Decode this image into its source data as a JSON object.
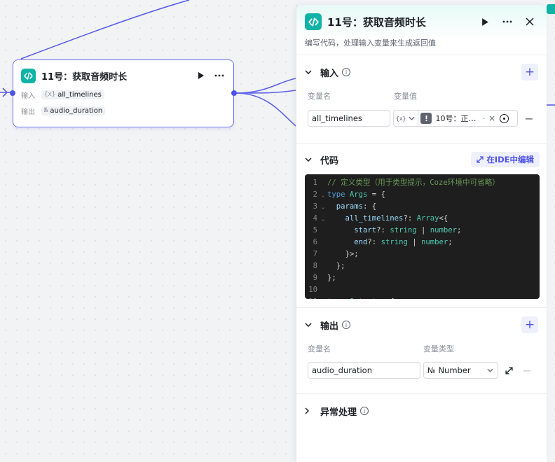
{
  "node": {
    "title": "11号：获取音频时长",
    "input_label": "输入",
    "input_icon": "{x}",
    "input_value": "all_timelines",
    "output_label": "输出",
    "output_icon": "№",
    "output_value": "audio_duration"
  },
  "panel": {
    "title": "11号：获取音频时长",
    "description": "编写代码，处理输入变量来生成返回值",
    "input_section": {
      "title": "输入",
      "col_name": "变量名",
      "col_value": "变量值",
      "var_name": "all_timelines",
      "ref_type_icon": "{x}",
      "ref_value": "10号：正…",
      "ref_suffix": "-",
      "ref_clear": "×"
    },
    "code_section": {
      "title": "代码",
      "ide_button": "在IDE中编辑",
      "lines": [
        "// 定义类型（用于类型提示，Coze环境中可省略）",
        "type Args = {",
        "  params: {",
        "    all_timelines?: Array<{",
        "      start?: string | number;",
        "      end?: string | number;",
        "    }>;",
        "  };",
        "};",
        "",
        "type Output = {"
      ]
    },
    "output_section": {
      "title": "输出",
      "col_name": "变量名",
      "col_type": "变量类型",
      "var_name": "audio_duration",
      "type_icon": "№",
      "type_value": "Number"
    },
    "exception_section": {
      "title": "异常处理"
    }
  },
  "colors": {
    "accent": "#4d53e8",
    "code_badge": "#10b3a6",
    "edge": "#5b5fe6"
  }
}
